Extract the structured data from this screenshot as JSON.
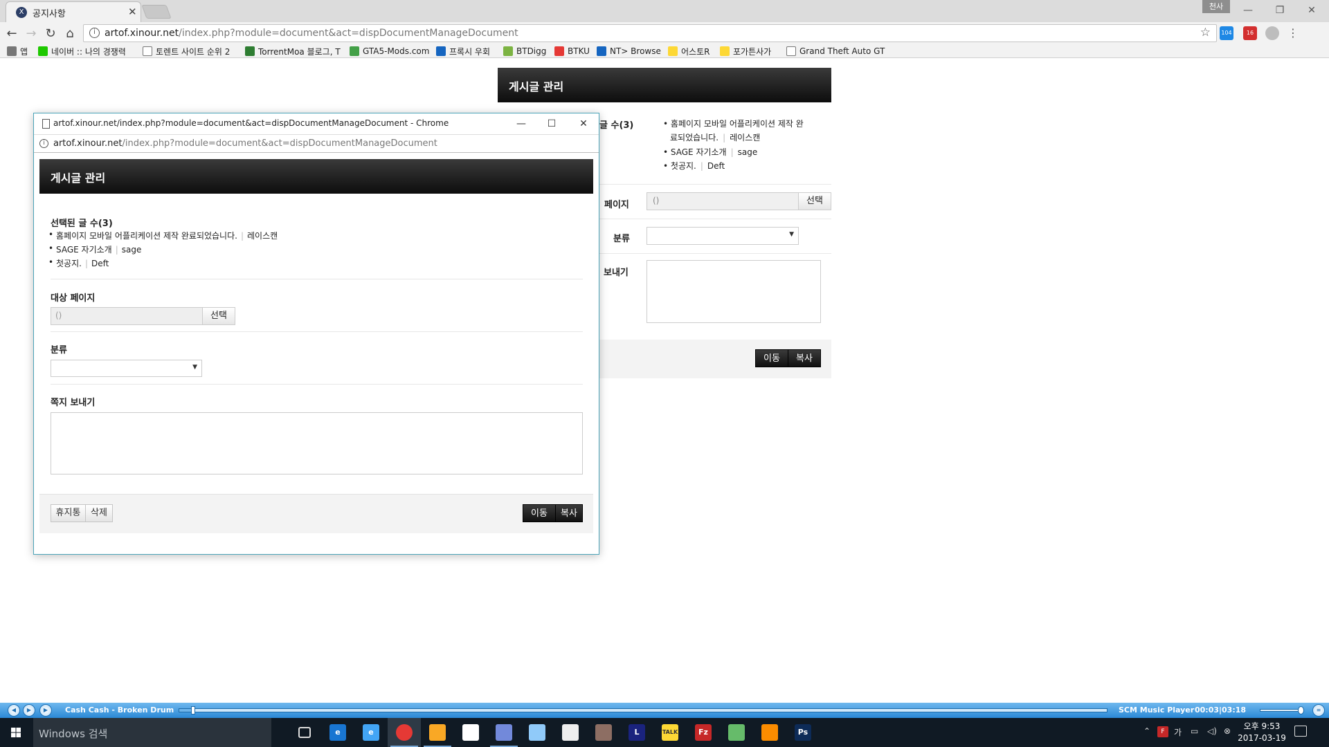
{
  "browser": {
    "tab_title": "공지사항",
    "tab_favicon": "X",
    "profile_label": "천사",
    "url_host": "artof.xinour.net",
    "url_path": "/index.php?module=document&act=dispDocumentManageDocument",
    "extensions": [
      {
        "name": "ext-badge-104",
        "label": "104",
        "color": "#1e88e5"
      },
      {
        "name": "adblock-icon",
        "label": "16",
        "color": "#d32f2f"
      }
    ],
    "bookmarks": [
      {
        "label": "앱",
        "icon": "apps-icon",
        "color": "#777777"
      },
      {
        "label": "네이버 :: 나의 경쟁력",
        "icon": "naver-icon",
        "color": "#1ec800"
      },
      {
        "label": "토렌트 사이트 순위 2",
        "icon": "page-icon",
        "color": "#ffffff"
      },
      {
        "label": "TorrentMoa 블로그, T",
        "icon": "torrentmoa-icon",
        "color": "#2e7d32"
      },
      {
        "label": "GTA5-Mods.com",
        "icon": "gta5mods-icon",
        "color": "#43a047"
      },
      {
        "label": "프록시 우회",
        "icon": "proxy-icon",
        "color": "#1565c0"
      },
      {
        "label": "BTDigg",
        "icon": "btdigg-icon",
        "color": "#7cb342"
      },
      {
        "label": "BTKU",
        "icon": "btku-icon",
        "color": "#e53935"
      },
      {
        "label": "NT> Browse",
        "icon": "nt-icon",
        "color": "#1565c0"
      },
      {
        "label": "어스토R",
        "icon": "folder-icon",
        "color": "#fdd835"
      },
      {
        "label": "포가튼사가",
        "icon": "folder-icon",
        "color": "#fdd835"
      },
      {
        "label": "Grand Theft Auto GT",
        "icon": "page-icon",
        "color": "#ffffff"
      }
    ]
  },
  "background_page": {
    "header": "게시글 관리",
    "selected_label": "글 수(3)",
    "items": [
      {
        "line1": "홈페이지 모바일 어플리케이션 제작 완",
        "line2": "료되었습니다.",
        "author": "레이스캔"
      },
      {
        "title": "SAGE 자기소개",
        "author": "sage"
      },
      {
        "title": "첫공지.",
        "author": "Deft"
      }
    ],
    "target_page_label": "페이지",
    "target_value": "()",
    "select_button": "선택",
    "category_label": "분류",
    "message_label": "보내기",
    "move_button": "이동",
    "copy_button": "복사"
  },
  "popup": {
    "window_title": "artof.xinour.net/index.php?module=document&act=dispDocumentManageDocument - Chrome",
    "url_host": "artof.xinour.net",
    "url_path": "/index.php?module=document&act=dispDocumentManageDocument",
    "header": "게시글 관리",
    "selected_label": "선택된 글 수(3)",
    "items": [
      {
        "title": "홈페이지 모바일 어플리케이션 제작 완료되었습니다.",
        "author": "레이스캔"
      },
      {
        "title": "SAGE 자기소개",
        "author": "sage"
      },
      {
        "title": "첫공지.",
        "author": "Deft"
      }
    ],
    "target_page_label": "대상 페이지",
    "target_value": "()",
    "select_button": "선택",
    "category_label": "분류",
    "message_label": "쪽지 보내기",
    "trash_button": "휴지통",
    "delete_button": "삭제",
    "move_button": "이동",
    "copy_button": "복사"
  },
  "music_player": {
    "song": "Cash Cash - Broken Drum",
    "app_name": "SCM Music Player",
    "time": "00:03|03:18",
    "progress": 0.014,
    "volume": 0.85
  },
  "taskbar": {
    "search_placeholder": "Windows 검색",
    "apps": [
      {
        "name": "task-view-icon",
        "label": "",
        "color": "#101a24"
      },
      {
        "name": "edge-icon",
        "label": "e",
        "color": "#1976d2"
      },
      {
        "name": "ie-icon",
        "label": "e",
        "color": "#42a5f5"
      },
      {
        "name": "chrome-icon",
        "label": "",
        "color": "#e53935"
      },
      {
        "name": "file-explorer-icon",
        "label": "",
        "color": "#f9a825"
      },
      {
        "name": "store-icon",
        "label": "",
        "color": "#ffffff"
      },
      {
        "name": "discord-icon",
        "label": "",
        "color": "#7289da"
      },
      {
        "name": "notepad-icon",
        "label": "",
        "color": "#90caf9"
      },
      {
        "name": "tencent-icon",
        "label": "",
        "color": "#eeeeee"
      },
      {
        "name": "media-icon",
        "label": "",
        "color": "#8d6e63"
      },
      {
        "name": "league-icon",
        "label": "L",
        "color": "#1a237e"
      },
      {
        "name": "kakaotalk-icon",
        "label": "TALK",
        "color": "#fdd835"
      },
      {
        "name": "filezilla-icon",
        "label": "Fz",
        "color": "#c62828"
      },
      {
        "name": "chat-bubbles-icon",
        "label": "",
        "color": "#66bb6a"
      },
      {
        "name": "smile-icon",
        "label": "",
        "color": "#fb8c00"
      },
      {
        "name": "photoshop-icon",
        "label": "Ps",
        "color": "#0d2b57"
      }
    ],
    "tray_ime": "가",
    "clock_time": "오후 9:53",
    "clock_date": "2017-03-19"
  }
}
